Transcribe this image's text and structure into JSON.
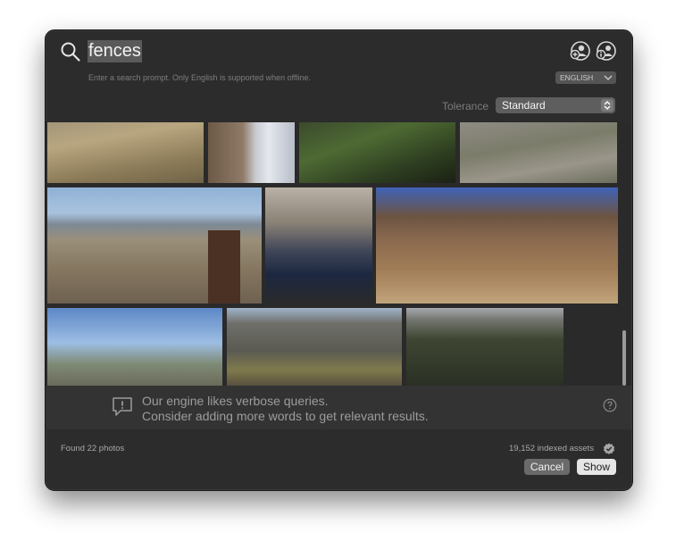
{
  "search": {
    "query": "fences",
    "hint": "Enter a search prompt. Only English is supported when offline."
  },
  "header_icons": [
    "add-person-icon",
    "person-info-icon"
  ],
  "language": {
    "value": "ENGLISH"
  },
  "tolerance": {
    "label": "Tolerance",
    "value": "Standard"
  },
  "photos": [
    {
      "name": "photo-desert-hillside"
    },
    {
      "name": "photo-stone-wall-sky"
    },
    {
      "name": "photo-green-plants"
    },
    {
      "name": "photo-rocky-ground"
    },
    {
      "name": "photo-metal-fence-valley"
    },
    {
      "name": "photo-gate-blue-car"
    },
    {
      "name": "photo-wooden-fence-ruins"
    },
    {
      "name": "photo-houses-railing"
    },
    {
      "name": "photo-mountain-wood-fence"
    },
    {
      "name": "photo-dusk-field"
    }
  ],
  "banner": {
    "line1": "Our engine likes verbose queries.",
    "line2": "Consider adding more words to get relevant results."
  },
  "footer": {
    "found": "Found 22 photos",
    "indexed": "19,152 indexed assets",
    "cancel_label": "Cancel",
    "show_label": "Show"
  }
}
